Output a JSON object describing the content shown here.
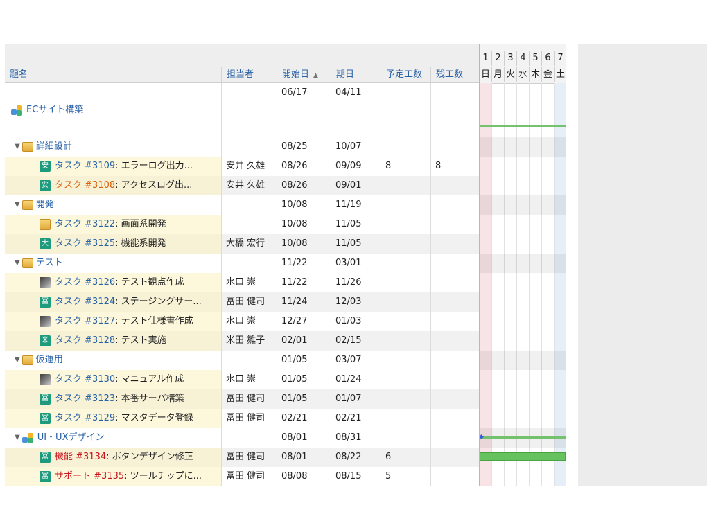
{
  "columns": {
    "title": "題名",
    "assignee": "担当者",
    "start": "開始日",
    "start_sort": "▲",
    "due": "期日",
    "estimated": "予定工数",
    "remaining": "残工数"
  },
  "gantt": {
    "day_numbers": [
      "1",
      "2",
      "3",
      "4",
      "5",
      "6",
      "7"
    ],
    "weekdays": [
      "日",
      "月",
      "火",
      "水",
      "木",
      "金",
      "土"
    ]
  },
  "rows": [
    {
      "kind": "project",
      "title": "ECサイト構築",
      "start": "06/17",
      "due": "04/11"
    },
    {
      "kind": "group",
      "title": "詳細設計",
      "start": "08/25",
      "due": "10/07"
    },
    {
      "kind": "task",
      "tracker": "タスク",
      "num": "#3109",
      "rest": ": エラーログ出力...",
      "avatar": "安",
      "assignee": "安井 久雄",
      "start": "08/26",
      "due": "09/09",
      "est": "8",
      "rem": "8"
    },
    {
      "kind": "task",
      "tracker": "タスク",
      "num": "#3108",
      "rest": ": アクセスログ出...",
      "avatar": "安",
      "assignee": "安井 久雄",
      "start": "08/26",
      "due": "09/01",
      "est": "",
      "rem": ""
    },
    {
      "kind": "group",
      "title": "開発",
      "start": "10/08",
      "due": "11/19"
    },
    {
      "kind": "task",
      "tracker": "タスク",
      "num": "#3122",
      "rest": ": 画面系開発",
      "avatar": "",
      "assignee": "",
      "start": "10/08",
      "due": "11/05",
      "est": "",
      "rem": ""
    },
    {
      "kind": "task",
      "tracker": "タスク",
      "num": "#3125",
      "rest": ": 機能系開発",
      "avatar": "大",
      "assignee": "大橋 宏行",
      "start": "10/08",
      "due": "11/05",
      "est": "",
      "rem": ""
    },
    {
      "kind": "group",
      "title": "テスト",
      "start": "11/22",
      "due": "03/01"
    },
    {
      "kind": "task",
      "tracker": "タスク",
      "num": "#3126",
      "rest": ": テスト観点作成",
      "avatar": "",
      "assignee": "水口 崇",
      "start": "11/22",
      "due": "11/26",
      "est": "",
      "rem": ""
    },
    {
      "kind": "task",
      "tracker": "タスク",
      "num": "#3124",
      "rest": ": ステージングサー...",
      "avatar": "冨",
      "assignee": "冨田 健司",
      "start": "11/24",
      "due": "12/03",
      "est": "",
      "rem": ""
    },
    {
      "kind": "task",
      "tracker": "タスク",
      "num": "#3127",
      "rest": ": テスト仕様書作成",
      "avatar": "",
      "assignee": "水口 崇",
      "start": "12/27",
      "due": "01/03",
      "est": "",
      "rem": ""
    },
    {
      "kind": "task",
      "tracker": "タスク",
      "num": "#3128",
      "rest": ": テスト実施",
      "avatar": "米",
      "assignee": "米田 雛子",
      "start": "02/01",
      "due": "02/15",
      "est": "",
      "rem": ""
    },
    {
      "kind": "group",
      "title": "仮運用",
      "start": "01/05",
      "due": "03/07"
    },
    {
      "kind": "task",
      "tracker": "タスク",
      "num": "#3130",
      "rest": ": マニュアル作成",
      "avatar": "",
      "assignee": "水口 崇",
      "start": "01/05",
      "due": "01/24",
      "est": "",
      "rem": ""
    },
    {
      "kind": "task",
      "tracker": "タスク",
      "num": "#3123",
      "rest": ": 本番サーバ構築",
      "avatar": "冨",
      "assignee": "冨田 健司",
      "start": "01/05",
      "due": "01/07",
      "est": "",
      "rem": ""
    },
    {
      "kind": "task",
      "tracker": "タスク",
      "num": "#3129",
      "rest": ": マスタデータ登録",
      "avatar": "冨",
      "assignee": "冨田 健司",
      "start": "02/21",
      "due": "02/21",
      "est": "",
      "rem": ""
    },
    {
      "kind": "group",
      "title": "UI・UXデザイン",
      "start": "08/01",
      "due": "08/31"
    },
    {
      "kind": "task",
      "tracker": "機能",
      "num": "#3134",
      "rest": ": ボタンデザイン修正",
      "avatar": "冨",
      "assignee": "冨田 健司",
      "start": "08/01",
      "due": "08/22",
      "est": "6",
      "rem": ""
    },
    {
      "kind": "task",
      "tracker": "サポート",
      "num": "#3135",
      "rest": ": ツールチップに...",
      "avatar": "冨",
      "assignee": "冨田 健司",
      "start": "08/08",
      "due": "08/15",
      "est": "5",
      "rem": ""
    }
  ],
  "colors": {
    "link": "#2a62a6",
    "tracker_alt": "#d9620b",
    "tracker_red": "#c8161d",
    "avatar": "#1e9b7c",
    "bar": "#66c25f"
  }
}
